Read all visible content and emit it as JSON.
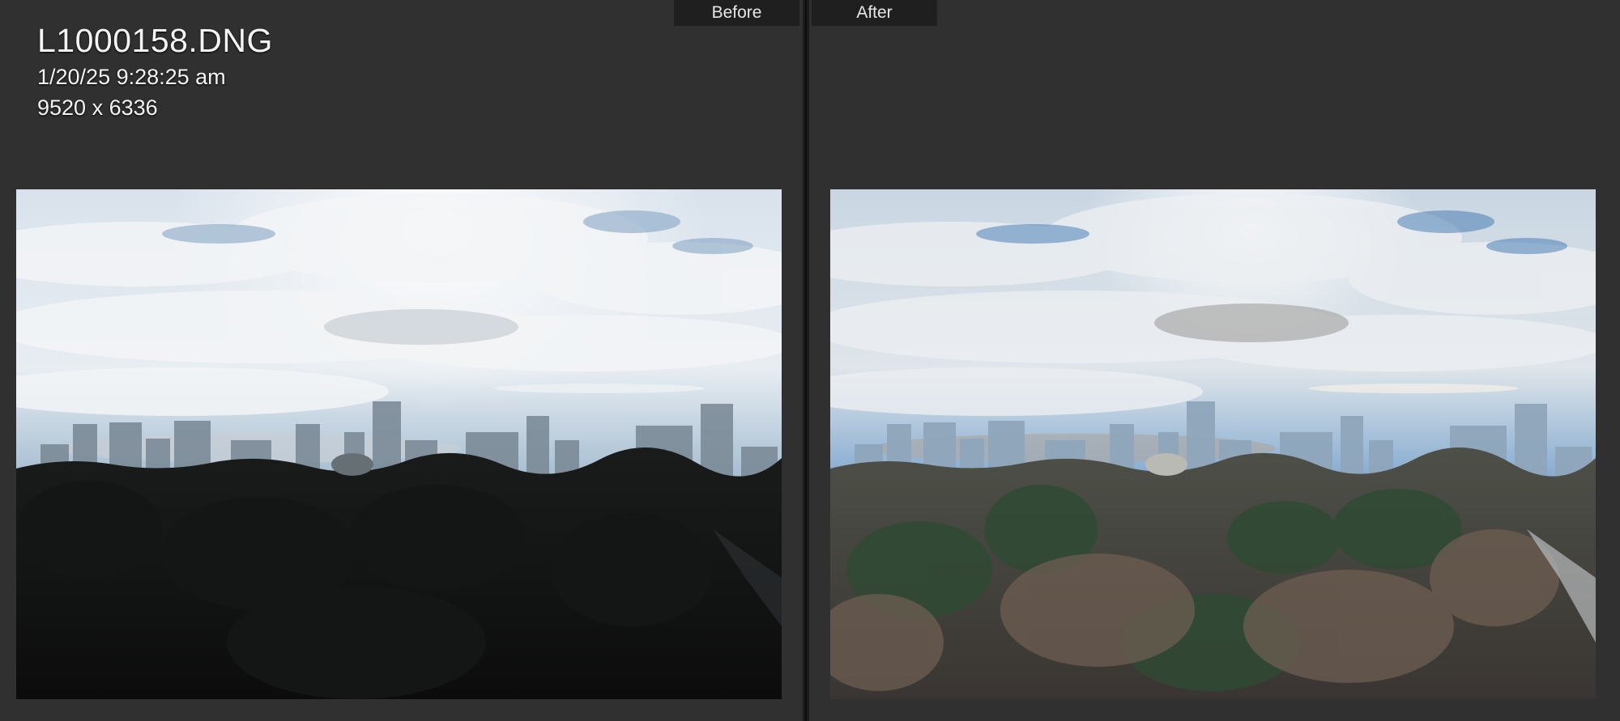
{
  "compare": {
    "before_label": "Before",
    "after_label": "After"
  },
  "info": {
    "filename": "L1000158.DNG",
    "datetime": "1/20/25 9:28:25 am",
    "dimensions": "9520 x 6336"
  },
  "colors": {
    "background": "#303030",
    "tab_background": "#1f1f1f",
    "divider": "#1b1b1b",
    "text": "#f4f4f4"
  }
}
